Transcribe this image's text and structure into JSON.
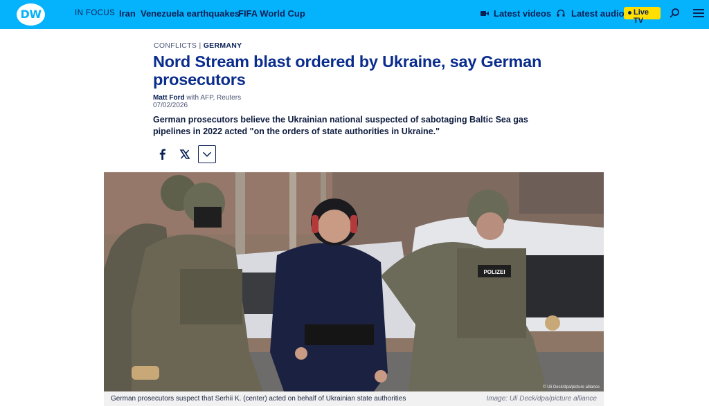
{
  "header": {
    "logo": "DW",
    "nav": {
      "in_focus": "IN FOCUS",
      "links": [
        "Iran",
        "Venezuela earthquakes",
        "FIFA World Cup"
      ],
      "latest_videos": "Latest videos",
      "latest_audio": "Latest audio",
      "live_tv": "Live TV"
    },
    "colors": {
      "bar": "#05b2fc",
      "live": "#ffdf00",
      "text": "#0a2156"
    }
  },
  "article": {
    "category": "CONFLICTS",
    "separator": "|",
    "country": "GERMANY",
    "headline": "Nord Stream blast ordered by Ukraine, say German prosecutors",
    "author": "Matt Ford",
    "agencies": "with AFP, Reuters",
    "date": "07/02/2026",
    "teaser": "German prosecutors believe the Ukrainian national suspected of sabotaging Baltic Sea gas pipelines in 2022 acted \"on the orders of state authorities in Ukraine.\"",
    "share": [
      "facebook-icon",
      "x-icon",
      "chevron-down-icon"
    ],
    "headline_color": "#0a2c8c"
  },
  "image": {
    "small_credit": "© Uli Deck/dpa/picture alliance",
    "caption": "German prosecutors suspect that Serhii K. (center) acted on behalf of Ukrainian state authorities",
    "credit": "Image: Uli Deck/dpa/picture alliance"
  }
}
